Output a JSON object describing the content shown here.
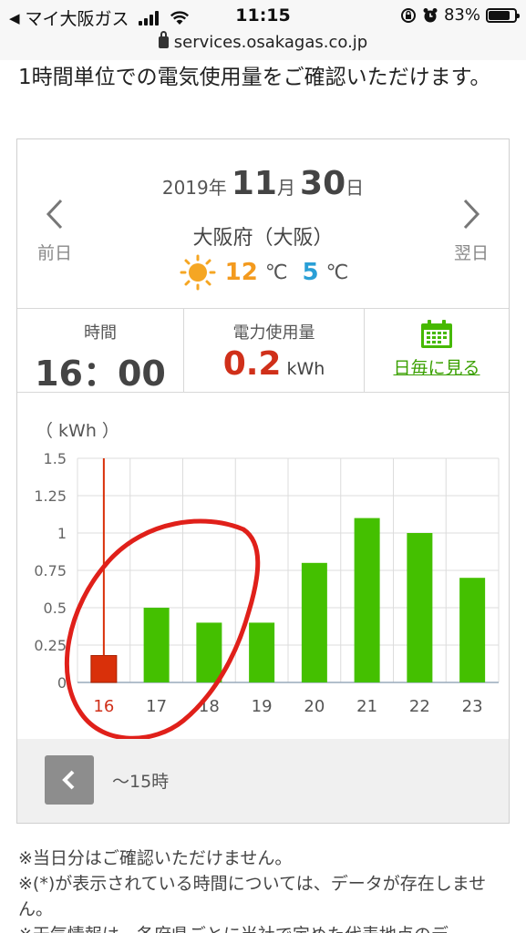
{
  "status_bar": {
    "back_app": "マイ大阪ガス",
    "time": "11:15",
    "battery": "83%",
    "battery_level": 0.83
  },
  "url": "services.osakagas.co.jp",
  "intro_text": "1時間単位での電気使用量をご確認いただけます。",
  "day_header": {
    "prev_label": "前日",
    "next_label": "翌日",
    "year": "2019",
    "year_suffix": "年",
    "month": "11",
    "month_suffix": "月",
    "day": "30",
    "day_suffix": "日",
    "prefecture": "大阪府（大阪）",
    "weather_icon": "sun-icon",
    "temp_high": "12",
    "temp_low": "5",
    "temp_unit": "℃",
    "colors": {
      "temp_high": "#f39a1e",
      "temp_low": "#2a9fd6"
    }
  },
  "info": {
    "time_header": "時間",
    "time_value": "16：00",
    "usage_header": "電力使用量",
    "usage_value": "0.2",
    "usage_unit": "kWh",
    "daily_link": "日毎に見る"
  },
  "chart_data": {
    "type": "bar",
    "unit_label": "（ kWh ）",
    "categories": [
      "16",
      "17",
      "18",
      "19",
      "20",
      "21",
      "22",
      "23"
    ],
    "values": [
      0.18,
      0.5,
      0.4,
      0.4,
      0.8,
      1.1,
      1.0,
      0.7
    ],
    "yticks": [
      "1.5",
      "1.25",
      "1",
      "0.75",
      "0.5",
      "0.25",
      "0"
    ],
    "ylim": [
      0,
      1.5
    ],
    "selected_index": 0,
    "grid": true,
    "colors": {
      "bar": "#44c000",
      "selected": "#d9300a",
      "selected_label": "#d0301a"
    }
  },
  "pager": {
    "prev_label": "〜15時"
  },
  "notes": [
    "※当日分はご確認いただけません。",
    "※(*)が表示されている時間については、データが存在しません。",
    "※天気情報は、各府県ごとに当社で定めた代表地点のデ"
  ]
}
